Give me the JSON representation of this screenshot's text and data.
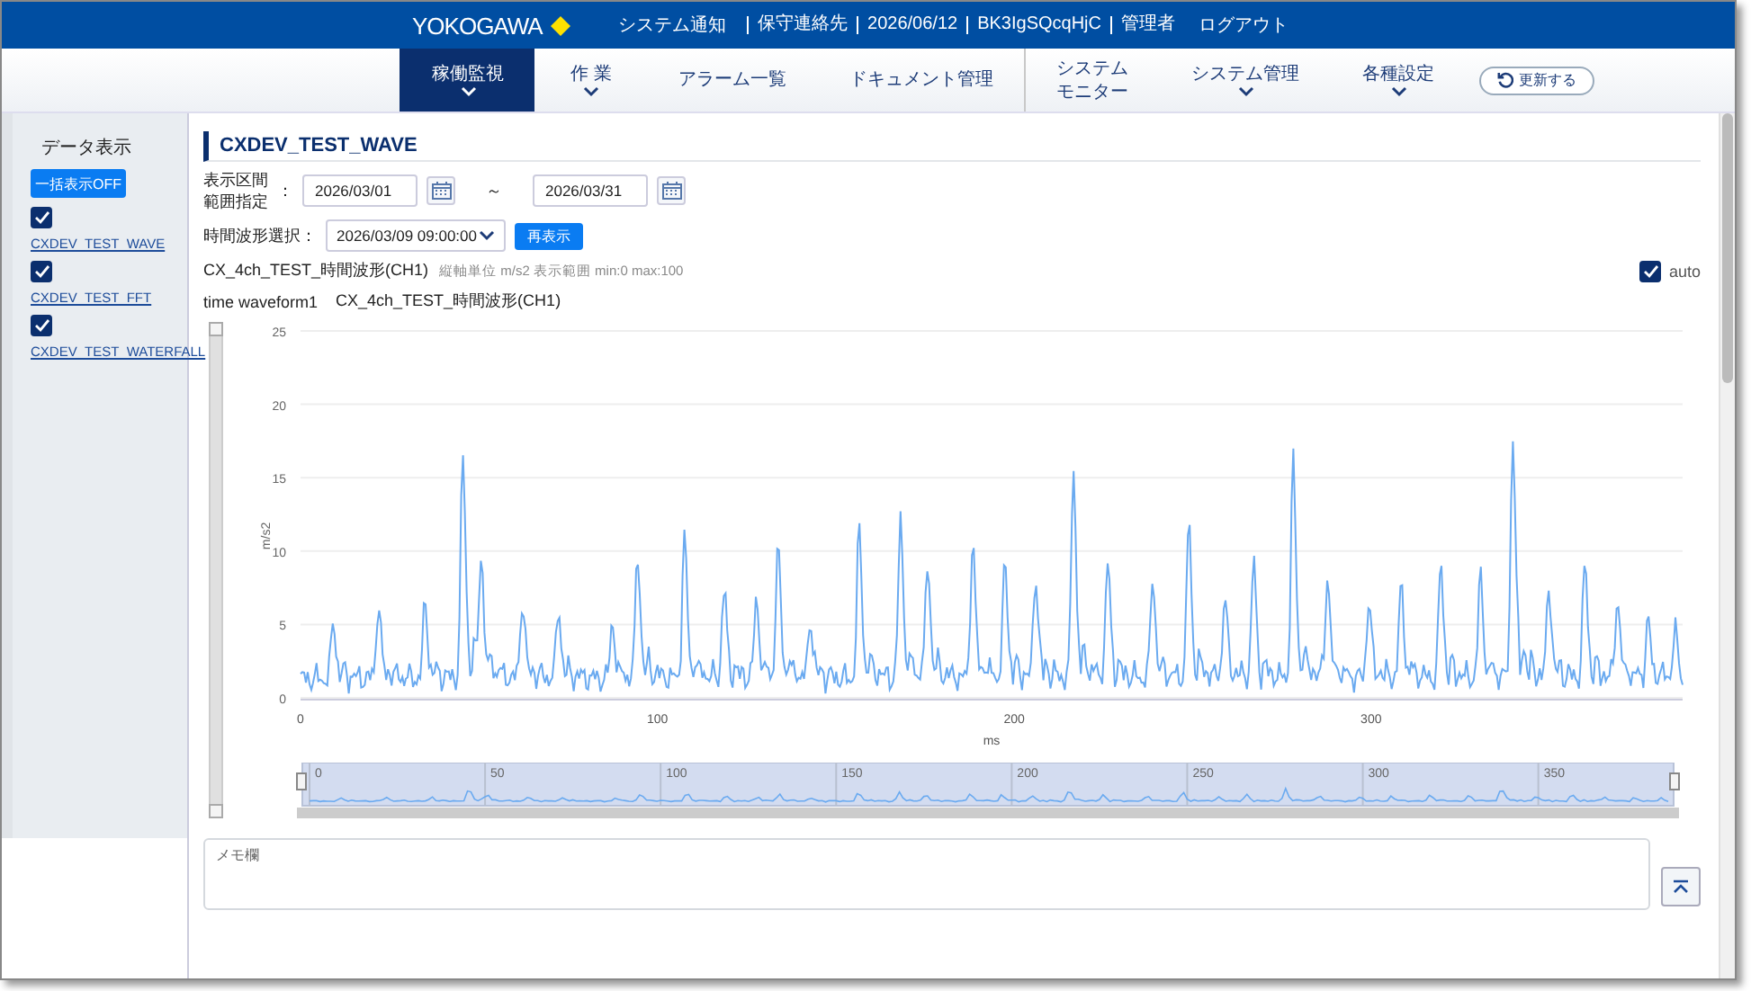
{
  "header": {
    "logo": "YOKOGAWA",
    "notice": "システム通知",
    "links": [
      "保守連絡先",
      "2026/06/12",
      "BK3IgSQcqHjC",
      "管理者"
    ],
    "logout": "ログアウト"
  },
  "nav": {
    "items": [
      {
        "lines": [
          "稼働監視"
        ],
        "selected": true,
        "dropdown": true,
        "divider_before": false
      },
      {
        "lines": [
          "作 業"
        ],
        "selected": false,
        "dropdown": true,
        "divider_before": false
      },
      {
        "lines": [
          "アラーム一覧"
        ],
        "selected": false,
        "dropdown": false,
        "divider_before": false
      },
      {
        "lines": [
          "ドキュメント管理"
        ],
        "selected": false,
        "dropdown": false,
        "divider_before": false
      },
      {
        "lines": [
          "システム",
          "モニター"
        ],
        "selected": false,
        "dropdown": false,
        "divider_before": true
      },
      {
        "lines": [
          "システム管理"
        ],
        "selected": false,
        "dropdown": true,
        "divider_before": false
      },
      {
        "lines": [
          "各種設定"
        ],
        "selected": false,
        "dropdown": true,
        "divider_before": false
      }
    ],
    "refresh": "更新する"
  },
  "sidebar": {
    "title": "データ表示",
    "toggle_all": "一括表示OFF",
    "items": [
      {
        "label": "CXDEV_TEST_WAVE",
        "checked": true
      },
      {
        "label": "CXDEV_TEST_FFT",
        "checked": true
      },
      {
        "label": "CXDEV_TEST_WATERFALL",
        "checked": true
      }
    ]
  },
  "main": {
    "title": "CXDEV_TEST_WAVE",
    "range": {
      "label_lines": [
        "表示区間",
        "範囲指定"
      ],
      "colon": "：",
      "from": "2026/03/01",
      "separator": "～",
      "to": "2026/03/31"
    },
    "wave_select": {
      "label": "時間波形選択：",
      "value": "2026/03/09 09:00:00",
      "button": "再表示"
    },
    "chart_header": {
      "title": "CX_4ch_TEST_時間波形(CH1)",
      "note": "縦軸単位 m/s2 表示範囲 min:0 max:100",
      "auto_label": "auto",
      "auto_checked": true
    },
    "legend": [
      "time waveform1",
      "CX_4ch_TEST_時間波形(CH1)"
    ],
    "y_zoom": {
      "level": 1
    },
    "chart": {
      "ylabel": "m/s2",
      "yticks": [
        "25",
        "20",
        "15",
        "10",
        "5",
        "0"
      ],
      "xticks": [
        "0",
        "100",
        "200",
        "300"
      ],
      "xlabel": "ms",
      "navigator_ticks": [
        "0",
        "50",
        "100",
        "150",
        "200",
        "250",
        "300",
        "350"
      ]
    },
    "memo": {
      "placeholder": "メモ欄"
    }
  }
}
